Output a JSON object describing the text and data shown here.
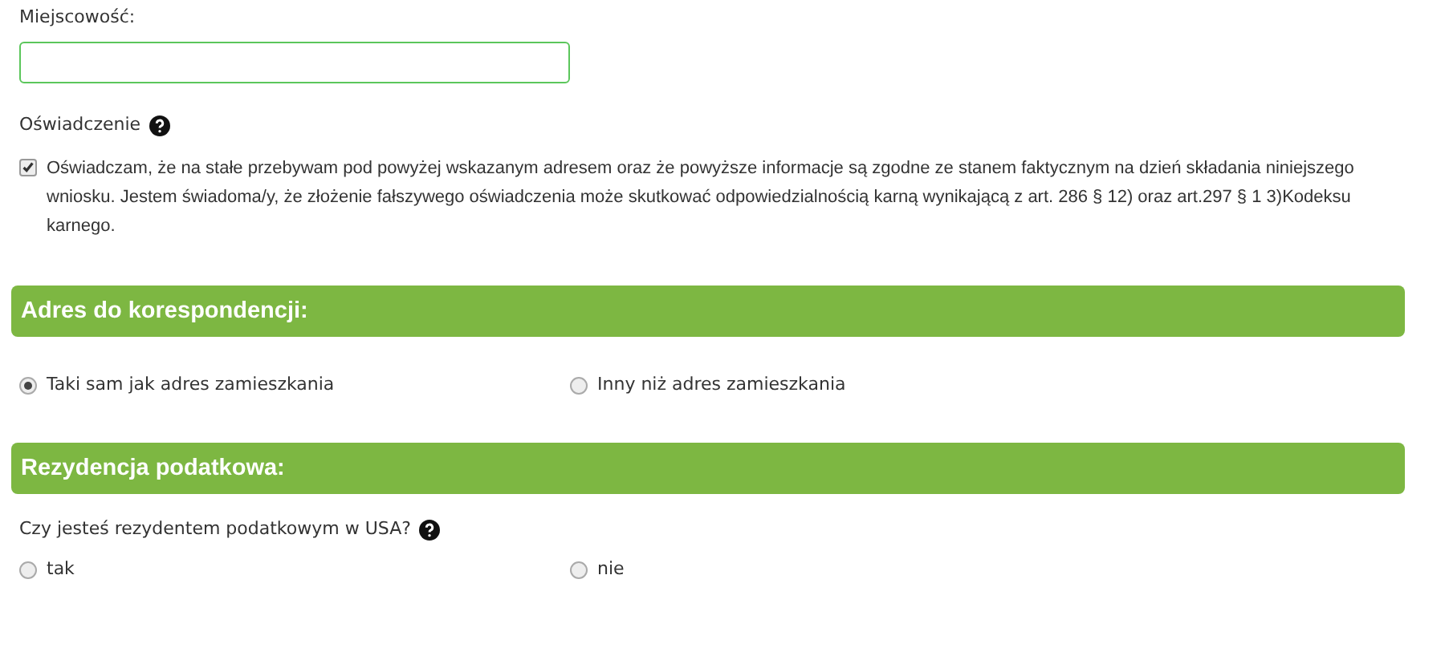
{
  "locality": {
    "label": "Miejscowość:"
  },
  "declaration": {
    "title": "Oświadczenie",
    "checked": true,
    "text": "Oświadczam, że na stałe przebywam pod powyżej wskazanym adresem oraz że powyższe informacje są zgodne ze stanem faktycznym na dzień składania niniejszego wniosku. Jestem świadoma/y, że złożenie fałszywego oświadczenia może skutkować odpowiedzialnością karną wynikającą z art. 286 § 12) oraz art.297 § 1 3)Kodeksu karnego."
  },
  "sections": [
    {
      "title": "Adres do korespondencji:",
      "options": [
        {
          "label": "Taki sam jak adres zamieszkania",
          "selected": true
        },
        {
          "label": "Inny niż adres zamieszkania",
          "selected": false
        }
      ]
    },
    {
      "title": "Rezydencja podatkowa:",
      "question": "Czy jesteś rezydentem podatkowym w USA?",
      "options": [
        {
          "label": "tak",
          "selected": false
        },
        {
          "label": "nie",
          "selected": false
        }
      ]
    }
  ]
}
